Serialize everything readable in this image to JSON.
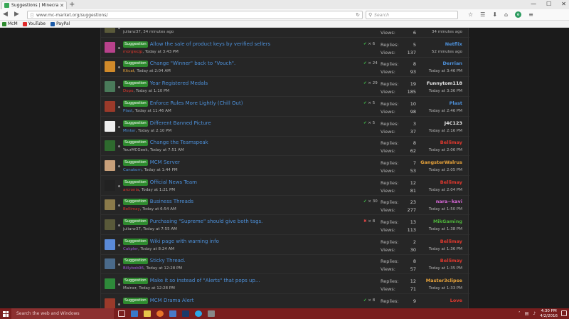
{
  "browser": {
    "tab_title": "Suggestions | Minecraft M...",
    "url": "www.mc-market.org/suggestions/",
    "search_placeholder": "Search",
    "bookmarks": [
      "McM",
      "YouTube",
      "PayPal"
    ]
  },
  "labels": {
    "replies": "Replies:",
    "views": "Views:"
  },
  "colors": {
    "prefix_bg": "#2e8b2e",
    "title_link": "#4d90d9",
    "taskbar": "#7a1e1e"
  },
  "threads": [
    {
      "prefix": "",
      "title": "",
      "author": "julianz37",
      "author_color": "#b5b5b5",
      "date": ", 34 minutes ago",
      "votes": "",
      "vote_type": "",
      "replies": "",
      "views": "6",
      "last_user": "",
      "last_user_color": "#d0d0d0",
      "last_time": "34 minutes ago",
      "avatar_color": "#5a5a3a"
    },
    {
      "prefix": "Suggestion",
      "title": "Allow the sale of product keys by verified sellers",
      "author": "morgiecjp",
      "author_color": "#e0382e",
      "date": ", Today at 3:43 PM",
      "votes": "× 6",
      "vote_type": "check",
      "replies": "5",
      "views": "137",
      "last_user": "Netflix",
      "last_user_color": "#4d90d9",
      "last_time": "52 minutes ago",
      "avatar_color": "#b8428c"
    },
    {
      "prefix": "Suggestion",
      "title": "Change \"Winner\" back to \"Vouch\".",
      "author": "Kitcat",
      "author_color": "#e8a33a",
      "date": ", Today at 2:04 AM",
      "votes": "× 24",
      "vote_type": "check",
      "replies": "8",
      "views": "93",
      "last_user": "Derrian",
      "last_user_color": "#4d90d9",
      "last_time": "Today at 3:46 PM",
      "avatar_color": "#d08a2a"
    },
    {
      "prefix": "Suggestion",
      "title": "Year Registered Medals",
      "author": "Dopo",
      "author_color": "#e0382e",
      "date": ", Today at 1:10 PM",
      "votes": "× 29",
      "vote_type": "check",
      "replies": "19",
      "views": "185",
      "last_user": "Funnytom118",
      "last_user_color": "#e8e8e8",
      "last_time": "Today at 3:36 PM",
      "avatar_color": "#4a7a5a"
    },
    {
      "prefix": "Suggestion",
      "title": "Enforce Rules More Lightly (Chill Out)",
      "author": "Plast",
      "author_color": "#4d90d9",
      "date": ", Today at 11:46 AM",
      "votes": "× 5",
      "vote_type": "check",
      "replies": "10",
      "views": "98",
      "last_user": "Plast",
      "last_user_color": "#4d90d9",
      "last_time": "Today at 2:46 PM",
      "avatar_color": "#9a3a2a"
    },
    {
      "prefix": "Suggestion",
      "title": "Different Banned Picture",
      "author": "Minter",
      "author_color": "#4d90d9",
      "date": ", Today at 2:10 PM",
      "votes": "× 5",
      "vote_type": "check",
      "replies": "3",
      "views": "37",
      "last_user": "J4C123",
      "last_user_color": "#e8e8e8",
      "last_time": "Today at 2:16 PM",
      "avatar_color": "#eeeeee"
    },
    {
      "prefix": "Suggestion",
      "title": "Change the Teamspeak",
      "author": "YourMCGeek",
      "author_color": "#b5b5b5",
      "date": ", Today at 7:51 AM",
      "votes": "",
      "vote_type": "",
      "replies": "8",
      "views": "62",
      "last_user": "Bellimay",
      "last_user_color": "#e0382e",
      "last_time": "Today at 2:06 PM",
      "avatar_color": "#2e6a2e"
    },
    {
      "prefix": "Suggestion",
      "title": "MCM Server",
      "author": "Canakorn",
      "author_color": "#4d90d9",
      "date": ", Today at 1:44 PM",
      "votes": "",
      "vote_type": "",
      "replies": "7",
      "views": "53",
      "last_user": "GangsterWalrus",
      "last_user_color": "#e8a33a",
      "last_time": "Today at 2:05 PM",
      "avatar_color": "#c8a07a"
    },
    {
      "prefix": "Suggestion",
      "title": "Official News Team",
      "author": "arcronia",
      "author_color": "#e0382e",
      "date": ", Today at 1:21 PM",
      "votes": "",
      "vote_type": "",
      "replies": "12",
      "views": "81",
      "last_user": "Bellimay",
      "last_user_color": "#e0382e",
      "last_time": "Today at 2:04 PM",
      "avatar_color": "#222222"
    },
    {
      "prefix": "Suggestion",
      "title": "Business Threads",
      "author": "Bellimay",
      "author_color": "#e0382e",
      "date": ", Today at 6:54 AM",
      "votes": "× 30",
      "vote_type": "check",
      "replies": "23",
      "views": "277",
      "last_user": "nara~kavi",
      "last_user_color": "#d868d8",
      "last_time": "Today at 1:50 PM",
      "avatar_color": "#8a7a4a"
    },
    {
      "prefix": "Suggestion",
      "title": "Purchasing \"Supreme\" should give both tags.",
      "author": "julianz37",
      "author_color": "#b5b5b5",
      "date": ", Today at 7:55 AM",
      "votes": "× 8",
      "vote_type": "cross",
      "replies": "13",
      "views": "113",
      "last_user": "MikGaming",
      "last_user_color": "#4caf3a",
      "last_time": "Today at 1:38 PM",
      "avatar_color": "#5a5a3a"
    },
    {
      "prefix": "Suggestion",
      "title": "Wiki page with warning info",
      "author": "Cakpler",
      "author_color": "#a05ad8",
      "date": ", Today at 8:24 AM",
      "votes": "",
      "vote_type": "",
      "replies": "2",
      "views": "30",
      "last_user": "Bellimay",
      "last_user_color": "#e0382e",
      "last_time": "Today at 1:36 PM",
      "avatar_color": "#5a8ad8"
    },
    {
      "prefix": "Suggestion",
      "title": "Sticky Thread.",
      "author": "Billybob96",
      "author_color": "#a05ad8",
      "date": ", Today at 12:28 PM",
      "votes": "",
      "vote_type": "",
      "replies": "8",
      "views": "57",
      "last_user": "Bellimay",
      "last_user_color": "#e0382e",
      "last_time": "Today at 1:35 PM",
      "avatar_color": "#4a6a8a"
    },
    {
      "prefix": "Suggestion",
      "title": "Make it so instead of \"Alerts\" that pops up...",
      "author": "Mainer",
      "author_color": "#b5b5b5",
      "date": ", Today at 12:28 PM",
      "votes": "",
      "vote_type": "",
      "replies": "12",
      "views": "71",
      "last_user": "Master3clipse",
      "last_user_color": "#e8a33a",
      "last_time": "Today at 1:33 PM",
      "avatar_color": "#2e8a3a"
    },
    {
      "prefix": "Suggestion",
      "title": "MCM Drama Alert",
      "author": "",
      "author_color": "#b5b5b5",
      "date": "",
      "votes": "× 8",
      "vote_type": "check",
      "replies": "9",
      "views": "",
      "last_user": "Love",
      "last_user_color": "#e0382e",
      "last_time": "",
      "avatar_color": "#9a3a2a"
    }
  ],
  "taskbar": {
    "search_placeholder": "Search the web and Windows",
    "time": "4:30 PM",
    "date": "4/2/2016"
  }
}
